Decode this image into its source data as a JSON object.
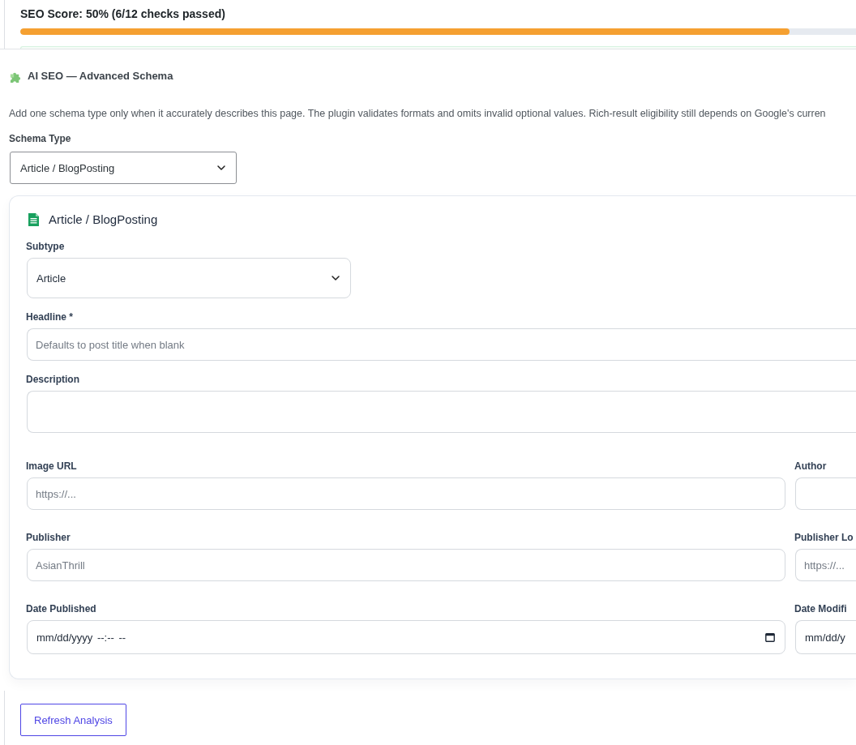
{
  "seo_score": {
    "label": "SEO Score: 50% (6/12 checks passed)",
    "level": 0.92
  },
  "schema_box": {
    "title": "AI SEO — Advanced Schema",
    "description": "Add one schema type only when it accurately describes this page. The plugin validates formats and omits invalid optional values. Rich-result eligibility still depends on Google's curren",
    "schema_type": {
      "label": "Schema Type",
      "value": "Article / BlogPosting"
    }
  },
  "schema_card": {
    "title": "Article / BlogPosting",
    "rows": [
      [
        {
          "kind": "select",
          "label": "Subtype",
          "value": "Article"
        }
      ],
      [
        {
          "kind": "text",
          "label": "Headline *",
          "placeholder": "Defaults to post title when blank"
        }
      ],
      [
        {
          "kind": "textarea",
          "label": "Description"
        }
      ],
      [
        {
          "kind": "text",
          "label": "Image URL",
          "placeholder": "https://..."
        },
        {
          "kind": "text",
          "label": "Author"
        }
      ],
      [
        {
          "kind": "text",
          "label": "Publisher",
          "placeholder": "AsianThrill"
        },
        {
          "kind": "text",
          "label": "Publisher Lo",
          "placeholder": "https://..."
        }
      ],
      [
        {
          "kind": "date",
          "label": "Date Published",
          "placeholder": "mm/dd/yyyy --:-- --"
        },
        {
          "kind": "date",
          "label": "Date Modifi",
          "placeholder": "mm/dd/y"
        }
      ]
    ]
  },
  "refresh_button": {
    "label": "Refresh Analysis"
  }
}
